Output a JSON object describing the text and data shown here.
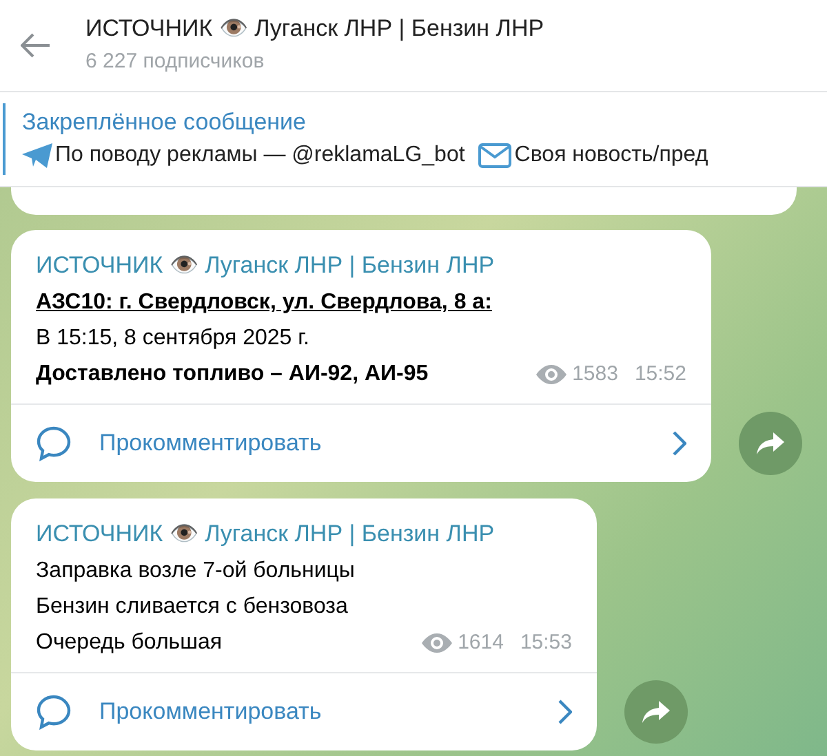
{
  "header": {
    "title": "ИСТОЧНИК 👁️ Луганск ЛНР | Бензин ЛНР",
    "subtitle": "6 227 подписчиков"
  },
  "pinned": {
    "label": "Закреплённое сообщение",
    "parts": [
      {
        "kind": "plane",
        "text": "По поводу рекламы — @reklamaLG_bot"
      },
      {
        "kind": "mail",
        "text": "Своя новость/пред"
      }
    ]
  },
  "messages": [
    {
      "author": "ИСТОЧНИК 👁️ Луганск ЛНР | Бензин ЛНР",
      "lines": [
        {
          "kind": "underlined",
          "text": "АЗС10: г. Свердловск, ул. Свердлова, 8 а:"
        },
        {
          "kind": "plain",
          "text": "В 15:15, 8 сентября 2025 г."
        },
        {
          "kind": "bold",
          "text": "Доставлено топливо – АИ-92, АИ-95"
        }
      ],
      "views": "1583",
      "time": "15:52",
      "comment": "Прокомментировать"
    },
    {
      "author": "ИСТОЧНИК 👁️ Луганск ЛНР | Бензин ЛНР",
      "lines": [
        {
          "kind": "plain",
          "text": "Заправка возле 7-ой больницы"
        },
        {
          "kind": "plain",
          "text": "Бензин сливается с бензовоза"
        },
        {
          "kind": "plain",
          "text": "Очередь большая"
        }
      ],
      "views": "1614",
      "time": "15:53",
      "comment": "Прокомментировать"
    }
  ]
}
